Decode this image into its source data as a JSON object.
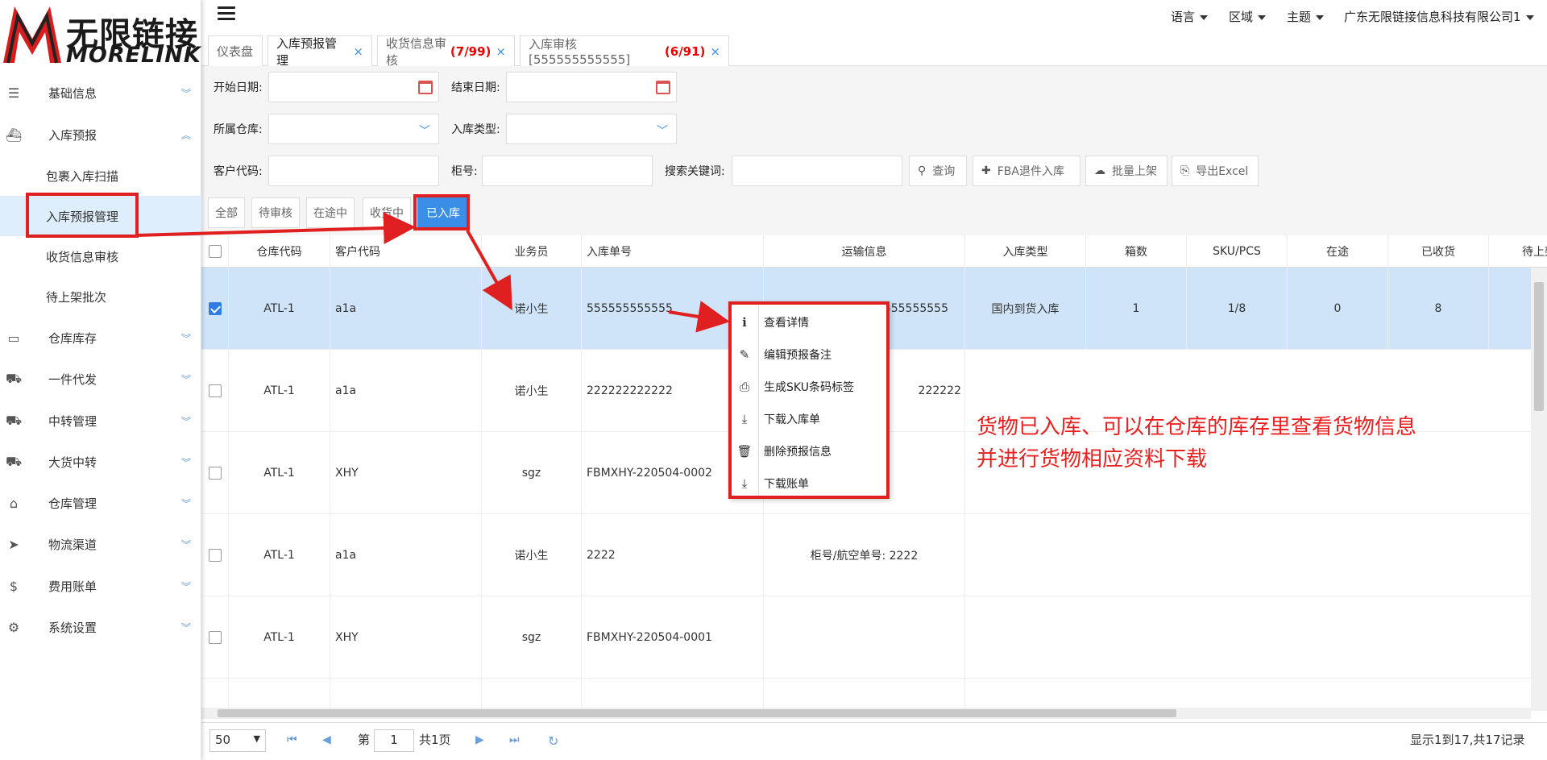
{
  "logo": {
    "cn": "无限链接",
    "en": "MORELINK"
  },
  "sidebar": {
    "items": [
      {
        "label": "基础信息",
        "icon": "list-icon"
      },
      {
        "label": "入库预报",
        "icon": "ship-icon"
      },
      {
        "label": "包裹入库扫描"
      },
      {
        "label": "入库预报管理"
      },
      {
        "label": "收货信息审核"
      },
      {
        "label": "待上架批次"
      },
      {
        "label": "仓库库存",
        "icon": "inbox-icon"
      },
      {
        "label": "一件代发",
        "icon": "truck-icon"
      },
      {
        "label": "中转管理",
        "icon": "truck-icon"
      },
      {
        "label": "大货中转",
        "icon": "truck-icon"
      },
      {
        "label": "仓库管理",
        "icon": "home-icon"
      },
      {
        "label": "物流渠道",
        "icon": "cursor-icon"
      },
      {
        "label": "费用账单",
        "icon": "dollar-icon"
      },
      {
        "label": "系统设置",
        "icon": "gear-icon"
      }
    ]
  },
  "header": {
    "language": "语言",
    "region": "区域",
    "theme": "主题",
    "company": "广东无限链接信息科技有限公司1"
  },
  "tabs": [
    {
      "label": "仪表盘",
      "count": ""
    },
    {
      "label": "入库预报管理",
      "count": ""
    },
    {
      "label": "收货信息审核",
      "count": "(7/99)"
    },
    {
      "label": "入库审核[555555555555]",
      "count": "(6/91)"
    }
  ],
  "filters": {
    "start_date": "开始日期:",
    "end_date": "结束日期:",
    "warehouse": "所属仓库:",
    "inbound_type": "入库类型:",
    "customer_code": "客户代码:",
    "container_no": "柜号:",
    "keyword": "搜索关键词:",
    "btn_query": "查询",
    "btn_fba_return": "FBA退件入库",
    "btn_batch_shelve": "批量上架",
    "btn_export": "导出Excel"
  },
  "status_tabs": [
    "全部",
    "待审核",
    "在途中",
    "收货中",
    "已入库"
  ],
  "table": {
    "headers": [
      "仓库代码",
      "客户代码",
      "业务员",
      "入库单号",
      "运输信息",
      "入库类型",
      "箱数",
      "SKU/PCS",
      "在途",
      "已收货",
      "待上架"
    ],
    "rows": [
      {
        "warehouse": "ATL-1",
        "customer": "a1a",
        "sales": "诺小生",
        "order": "555555555555",
        "transport": "555555555",
        "type": "国内到货入库",
        "boxes": "1",
        "sku": "1/8",
        "transit": "0",
        "received": "8"
      },
      {
        "warehouse": "ATL-1",
        "customer": "a1a",
        "sales": "诺小生",
        "order": "222222222222",
        "transport": "222222",
        "type": "",
        "boxes": "",
        "sku": "",
        "transit": "",
        "received": ""
      },
      {
        "warehouse": "ATL-1",
        "customer": "XHY",
        "sales": "sgz",
        "order": "FBMXHY-220504-0002",
        "transport": "",
        "type": "",
        "boxes": "",
        "sku": "",
        "transit": "",
        "received": ""
      },
      {
        "warehouse": "ATL-1",
        "customer": "a1a",
        "sales": "诺小生",
        "order": "2222",
        "transport": "柜号/航空单号: 2222",
        "type": "",
        "boxes": "",
        "sku": "",
        "transit": "",
        "received": ""
      },
      {
        "warehouse": "ATL-1",
        "customer": "XHY",
        "sales": "sgz",
        "order": "FBMXHY-220504-0001",
        "transport": "",
        "type": "",
        "boxes": "",
        "sku": "",
        "transit": "",
        "received": ""
      }
    ]
  },
  "context_menu": [
    {
      "label": "查看详情",
      "icon": "info-icon"
    },
    {
      "label": "编辑预报备注",
      "icon": "pencil-icon"
    },
    {
      "label": "生成SKU条码标签",
      "icon": "print-icon"
    },
    {
      "label": "下载入库单",
      "icon": "download-icon"
    },
    {
      "label": "删除预报信息",
      "icon": "trash-icon"
    },
    {
      "label": "下载账单",
      "icon": "download-icon"
    }
  ],
  "pager": {
    "page_size": "50",
    "page_prefix": "第",
    "page_value": "1",
    "page_suffix": "共1页",
    "summary": "显示1到17,共17记录"
  },
  "annotation": {
    "line1": "货物已入库、可以在仓库的库存里查看货物信息",
    "line2": "并进行货物相应资料下载"
  },
  "colors": {
    "accent": "#3a8ee6",
    "annotation": "#e02020",
    "selected_row": "#cfe4f9"
  }
}
